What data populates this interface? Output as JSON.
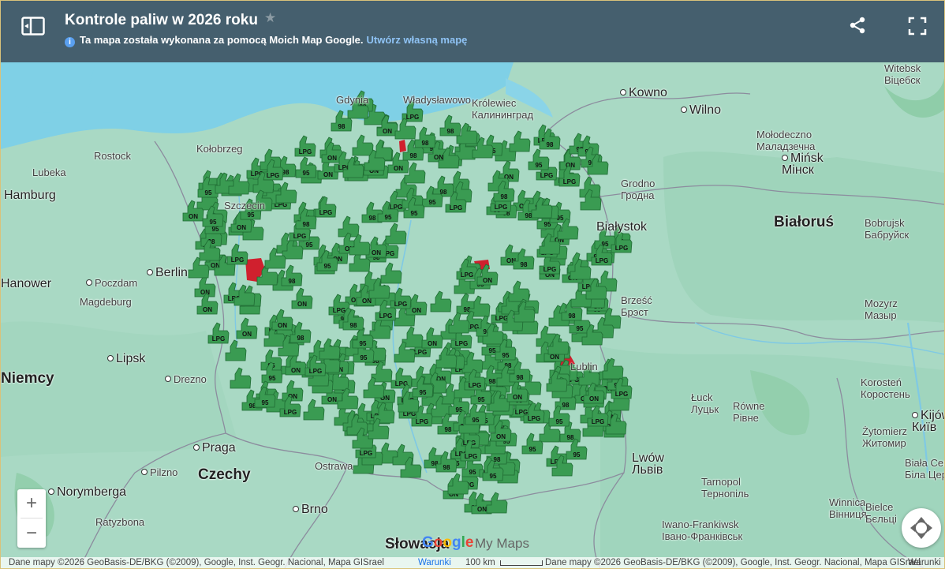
{
  "header": {
    "title": "Kontrole paliw w 2026 roku",
    "subtitle": "Ta mapa została wykonana za pomocą Moich Map Google.",
    "create_link": "Utwórz własną mapę"
  },
  "colors": {
    "header_bg": "#455f6e",
    "marker_green": "#3a9b52",
    "marker_red": "#d0202e",
    "water": "#7fd0e6",
    "land": "#a9d9c4"
  },
  "map": {
    "labels": [
      {
        "text": "Władysławowo",
        "cls": ""
      },
      {
        "text": "Królewiec\nКалининград",
        "cls": ""
      },
      {
        "text": "Kowno",
        "cls": "mid",
        "dot": true
      },
      {
        "text": "Wilno",
        "cls": "mid",
        "dot": true
      },
      {
        "text": "Witebsk\nВiцебск",
        "cls": ""
      },
      {
        "text": "Rostock",
        "cls": ""
      },
      {
        "text": "Lubeka",
        "cls": ""
      },
      {
        "text": "Hamburg",
        "cls": "mid"
      },
      {
        "text": "Kołobrzeg",
        "cls": ""
      },
      {
        "text": "Gdynia",
        "cls": ""
      },
      {
        "text": "Mołodeczno\nМаладзечна",
        "cls": ""
      },
      {
        "text": "Mińsk\nМінск",
        "cls": "mid",
        "dot": true
      },
      {
        "text": "Grodno\nГродна",
        "cls": ""
      },
      {
        "text": "Białoruś",
        "cls": "big"
      },
      {
        "text": "Bobrujsk\nБабруйск",
        "cls": ""
      },
      {
        "text": "Szczecin",
        "cls": ""
      },
      {
        "text": "Białystok",
        "cls": "mid"
      },
      {
        "text": "Poczdam",
        "cls": "",
        "dot": true
      },
      {
        "text": "Berlin",
        "cls": "mid",
        "dot": true
      },
      {
        "text": "Hanower",
        "cls": "mid"
      },
      {
        "text": "Magdeburg",
        "cls": ""
      },
      {
        "text": "Brześć\nБрэст",
        "cls": ""
      },
      {
        "text": "Mozyrz\nМазыр",
        "cls": ""
      },
      {
        "text": "Lipsk",
        "cls": "mid",
        "dot": true
      },
      {
        "text": "Niemcy",
        "cls": "big"
      },
      {
        "text": "Drezno",
        "cls": "",
        "dot": true
      },
      {
        "text": "Lublin",
        "cls": ""
      },
      {
        "text": "Łuck\nЛуцьк",
        "cls": ""
      },
      {
        "text": "Równe\nРівне",
        "cls": ""
      },
      {
        "text": "Korosteń\nКоростень",
        "cls": ""
      },
      {
        "text": "Praga",
        "cls": "mid",
        "dot": true
      },
      {
        "text": "Czechy",
        "cls": "big"
      },
      {
        "text": "Ostrawa",
        "cls": ""
      },
      {
        "text": "Pilzno",
        "cls": "",
        "dot": true
      },
      {
        "text": "Norymberga",
        "cls": "mid",
        "dot": true
      },
      {
        "text": "Lwów\nЛьвів",
        "cls": "mid"
      },
      {
        "text": "Żytomierz\nЖитомир",
        "cls": ""
      },
      {
        "text": "Tarnopol\nТернопіль",
        "cls": ""
      },
      {
        "text": "Brno",
        "cls": "mid",
        "dot": true
      },
      {
        "text": "Ratyzbona",
        "cls": ""
      },
      {
        "text": "Słowacja",
        "cls": "big"
      },
      {
        "text": "Iwano-Frankiwsk\nІвано-Франківськ",
        "cls": ""
      },
      {
        "text": "Winnica\nВінниця",
        "cls": ""
      },
      {
        "text": "Biała Cerkiew\nБіла Церква",
        "cls": ""
      },
      {
        "text": "Kijów\nКиїв",
        "cls": "mid",
        "dot": true
      },
      {
        "text": "Bielce\nБєльці",
        "cls": ""
      }
    ],
    "marker_labels": [
      "ON",
      "95",
      "98",
      "LPG"
    ]
  },
  "controls": {
    "zoom_in": "+",
    "zoom_out": "−"
  },
  "footer": {
    "attribution_left": "Dane mapy ©2026 GeoBasis-DE/BKG (©2009), Google, Inst. Geogr. Nacional, Mapa GISrael",
    "terms_left": "Warunki",
    "scale": "100 km",
    "attribution_right": "Dane mapy ©2026 GeoBasis-DE/BKG (©2009), Google, Inst. Geogr. Nacional, Mapa GISrael",
    "terms_right": "Warunki"
  },
  "branding": {
    "google": "Google",
    "mymaps": "My Maps"
  }
}
